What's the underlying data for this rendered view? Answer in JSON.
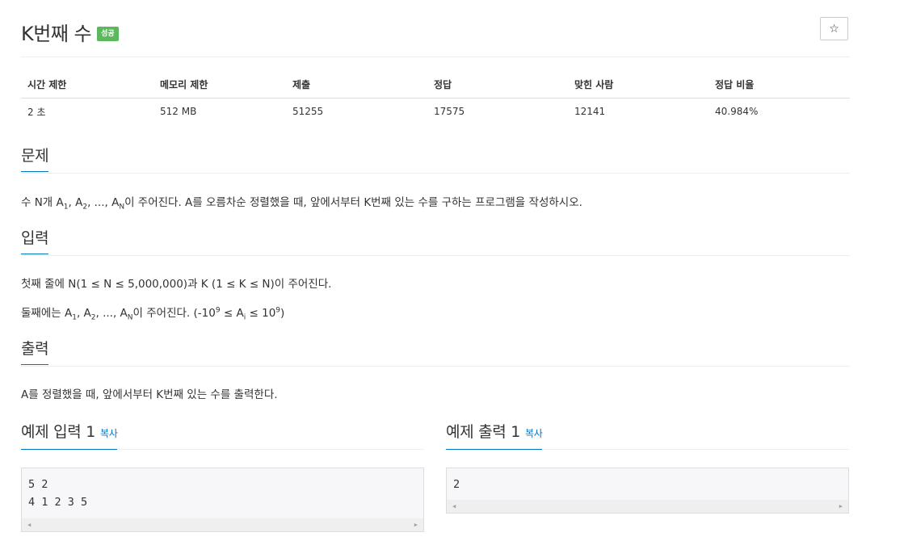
{
  "problem": {
    "title": "K번째 수",
    "badge": "성공"
  },
  "toolbar": {
    "star_label": "☆"
  },
  "info_table": {
    "headers": [
      "시간 제한",
      "메모리 제한",
      "제출",
      "정답",
      "맞힌 사람",
      "정답 비율"
    ],
    "values": [
      "2 초",
      "512 MB",
      "51255",
      "17575",
      "12141",
      "40.984%"
    ]
  },
  "description": {
    "heading": "문제",
    "text_1": "수 N개 A",
    "sub_1": "1",
    "text_2": ", A",
    "sub_2": "2",
    "text_3": ", ..., A",
    "sub_3": "N",
    "text_4": "이 주어진다. A를 오름차순 정렬했을 때, 앞에서부터 K번째 있는 수를 구하는 프로그램을 작성하시오."
  },
  "input": {
    "heading": "입력",
    "line1": "첫째 줄에 N(1 ≤ N ≤ 5,000,000)과 K (1 ≤ K ≤ N)이 주어진다.",
    "line2_a": "둘째에는 A",
    "line2_sub1": "1",
    "line2_b": ", A",
    "line2_sub2": "2",
    "line2_c": ", ..., A",
    "line2_subN": "N",
    "line2_d": "이 주어진다. (-10",
    "line2_sup1": "9",
    "line2_e": " ≤ A",
    "line2_subi": "i",
    "line2_f": " ≤ 10",
    "line2_sup2": "9",
    "line2_g": ")"
  },
  "output": {
    "heading": "출력",
    "text": "A를 정렬했을 때, 앞에서부터 K번째 있는 수를 출력한다."
  },
  "sample_input": {
    "heading": "예제 입력 1",
    "copy_label": "복사",
    "line1": "5 2",
    "line2": "4 1 2 3 5"
  },
  "sample_output": {
    "heading": "예제 출력 1",
    "copy_label": "복사",
    "line1": "2"
  },
  "scrollbar": {
    "left_arrow": "◀",
    "right_arrow": "▶"
  }
}
